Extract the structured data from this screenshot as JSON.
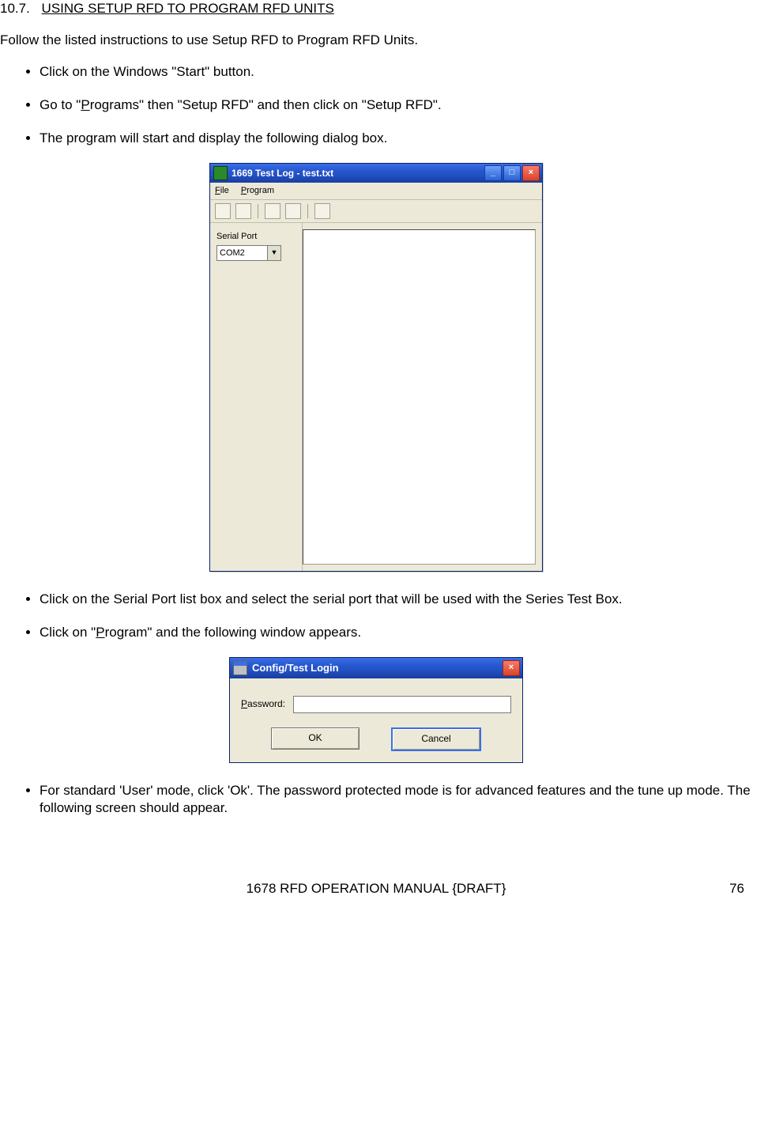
{
  "section": {
    "number": "10.7.",
    "title": "USING SETUP RFD TO PROGRAM RFD UNITS"
  },
  "intro": "Follow the listed instructions to use Setup RFD to Program RFD Units.",
  "bullets_top": {
    "b1": "Click on the Windows \"Start\" button.",
    "b2_pre": "Go to \"",
    "b2_u": "P",
    "b2_post": "rograms\" then \"Setup RFD\" and then click on \"Setup RFD\".",
    "b3": "The program will start and display the following dialog box."
  },
  "win1": {
    "title": "1669 Test Log - test.txt",
    "menu": {
      "file_u": "F",
      "file_rest": "ile",
      "program_u": "P",
      "program_rest": "rogram"
    },
    "side_label": "Serial Port",
    "combo_value": "COM2",
    "btn_min": "_",
    "btn_max": "□",
    "btn_close": "×"
  },
  "bullets_mid": {
    "b4": "Click on the Serial Port list box and select the serial port that will be used with the Series Test Box.",
    "b5_pre": "Click on \"",
    "b5_u": "P",
    "b5_post": "rogram\" and the following window appears."
  },
  "win2": {
    "title": "Config/Test Login",
    "pw_u": "P",
    "pw_rest": "assword:",
    "ok": "OK",
    "cancel": "Cancel",
    "btn_close": "×"
  },
  "bullets_bot": {
    "b6": "For standard 'User' mode, click 'Ok'.  The password protected mode is for advanced features and the tune up mode. The following screen should appear."
  },
  "footer_text": "1678 RFD OPERATION MANUAL {DRAFT}",
  "page_number": "76"
}
